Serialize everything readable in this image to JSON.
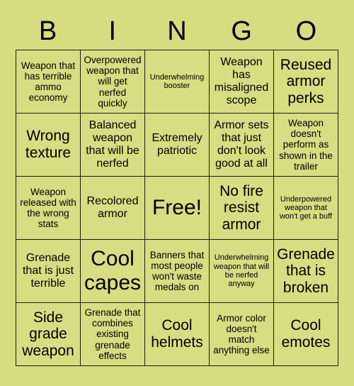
{
  "colors": {
    "background": "#d6dd80",
    "cell_fill": "#d7dd82",
    "grid_line": "#1d1d10",
    "text": "#000000"
  },
  "header": {
    "letters": [
      "B",
      "I",
      "N",
      "G",
      "O"
    ]
  },
  "grid": {
    "rows": 5,
    "columns": 5,
    "cells": [
      {
        "text": "Weapon that has terrible ammo economy",
        "size": "fs-sm"
      },
      {
        "text": "Overpowered weapon that will get nerfed quickly",
        "size": "fs-sm"
      },
      {
        "text": "Underwhelming booster",
        "size": "fs-xs"
      },
      {
        "text": "Weapon has misaligned scope",
        "size": "fs-md"
      },
      {
        "text": "Reused armor perks",
        "size": "fs-lg"
      },
      {
        "text": "Wrong texture",
        "size": "fs-lg"
      },
      {
        "text": "Balanced weapon that will be nerfed",
        "size": "fs-md"
      },
      {
        "text": "Extremely patriotic",
        "size": "fs-md"
      },
      {
        "text": "Armor sets that just don't look good at all",
        "size": "fs-md"
      },
      {
        "text": "Weapon doesn't perform as shown in the trailer",
        "size": "fs-sm"
      },
      {
        "text": "Weapon released with the wrong stats",
        "size": "fs-sm"
      },
      {
        "text": "Recolored armor",
        "size": "fs-md"
      },
      {
        "text": "Free!",
        "size": "fs-xl"
      },
      {
        "text": "No fire resist armor",
        "size": "fs-lg"
      },
      {
        "text": "Underpowered weapon that won't get a buff",
        "size": "fs-xs"
      },
      {
        "text": "Grenade that is just terrible",
        "size": "fs-md"
      },
      {
        "text": "Cool capes",
        "size": "fs-xl"
      },
      {
        "text": "Banners that most people won't waste medals on",
        "size": "fs-sm"
      },
      {
        "text": "Underwhelming weapon that will be nerfed anyway",
        "size": "fs-xs"
      },
      {
        "text": "Grenade that is broken",
        "size": "fs-lg"
      },
      {
        "text": "Side grade weapon",
        "size": "fs-lg"
      },
      {
        "text": "Grenade that combines existing grenade effects",
        "size": "fs-sm"
      },
      {
        "text": "Cool helmets",
        "size": "fs-lg"
      },
      {
        "text": "Armor color doesn't match anything else",
        "size": "fs-sm"
      },
      {
        "text": "Cool emotes",
        "size": "fs-lg"
      }
    ]
  }
}
